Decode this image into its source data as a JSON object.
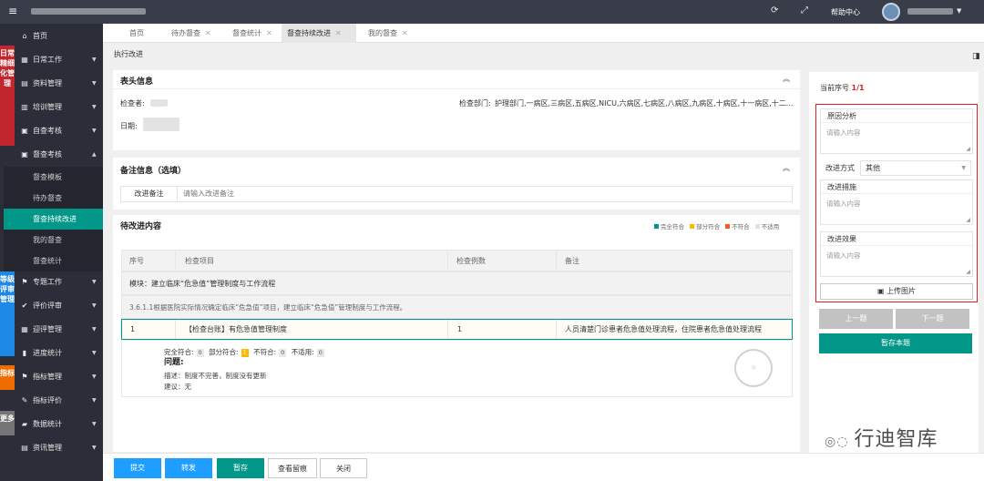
{
  "topbar": {
    "menu_icon": "hamburger-icon",
    "help_center": "帮助中心",
    "refresh_icon": "refresh-icon",
    "fullscreen_icon": "fullscreen-icon"
  },
  "sidebar": {
    "items": [
      {
        "label": "首页",
        "icon": "home-icon"
      },
      {
        "label": "日常工作",
        "icon": "calendar-icon"
      },
      {
        "label": "资料管理",
        "icon": "folder-icon"
      },
      {
        "label": "培训管理",
        "icon": "book-icon"
      },
      {
        "label": "自查考核",
        "icon": "clipboard-icon"
      },
      {
        "label": "督查考核",
        "icon": "clipboard-icon"
      },
      {
        "label": "专题工作",
        "icon": "flag-icon"
      },
      {
        "label": "评价评审",
        "icon": "check-icon"
      },
      {
        "label": "迎评管理",
        "icon": "doc-icon"
      },
      {
        "label": "进度统计",
        "icon": "chart-icon"
      },
      {
        "label": "指标管理",
        "icon": "flag-icon"
      },
      {
        "label": "指标评价",
        "icon": "wrench-icon"
      },
      {
        "label": "数据统计",
        "icon": "stats-icon"
      },
      {
        "label": "资讯管理",
        "icon": "news-icon"
      }
    ],
    "subitems": [
      {
        "label": "督查模板"
      },
      {
        "label": "待办督查"
      },
      {
        "label": "督查持续改进"
      },
      {
        "label": "我的督查"
      },
      {
        "label": "督查统计"
      }
    ],
    "tags": {
      "daily": "日常精细化管理",
      "grade": "等级评审管理",
      "index": "指标",
      "more": "更多"
    },
    "colors": {
      "daily": "#c1272d",
      "grade": "#1e88e5",
      "index": "#ef6c00",
      "more": "#757575"
    }
  },
  "tabs": [
    {
      "label": "首页"
    },
    {
      "label": "待办督查"
    },
    {
      "label": "督查统计"
    },
    {
      "label": "督查持续改进"
    },
    {
      "label": "我的督查"
    }
  ],
  "breadcrumb": "执行改进",
  "header_info": {
    "title": "表头信息",
    "inspector_label": "检查者:",
    "date_label": "日期:",
    "dept_label": "检查部门:",
    "dept_value": "护理部门,一病区,三病区,五病区,NICU,六病区,七病区,八病区,九病区,十病区,十一病区,十二..."
  },
  "remarks": {
    "title": "备注信息（选填）",
    "label": "改进备注",
    "placeholder": "请输入改进备注"
  },
  "pending": {
    "title": "待改进内容",
    "legend": [
      {
        "label": "完全符合",
        "color": "#009688"
      },
      {
        "label": "部分符合",
        "color": "#ffb800"
      },
      {
        "label": "不符合",
        "color": "#ff5722"
      },
      {
        "label": "不适用",
        "color": "#e2e2e2"
      }
    ],
    "columns": [
      "序号",
      "检查项目",
      "检查例数",
      "备注"
    ],
    "module": "模块：建立临床“危急值”管理制度与工作流程",
    "clause": "3.6.1.1根据医院实际情况确定临床“危急值”项目，建立临床“危急值”管理制度与工作流程。",
    "row": {
      "no": "1",
      "item": "【检查台账】有危急值管理制度",
      "count": "1",
      "note": "人员清楚门诊患者危急值处理流程，住院患者危急值处理流程"
    },
    "stats": {
      "full_label": "完全符合:",
      "full": "0",
      "part_label": "部分符合:",
      "part": "1",
      "non_label": "不符合:",
      "non": "0",
      "na_label": "不适用:",
      "na": "0"
    },
    "issue_title": "问题:",
    "desc": "描述：制度不完善，制度没有更新",
    "advice": "建议：无"
  },
  "right_panel": {
    "current_label": "当前序号",
    "current_value": "1/1",
    "cause_label": "原因分析",
    "cause_placeholder": "请输入内容",
    "method_label": "改进方式",
    "method_value": "其他",
    "measure_label": "改进措施",
    "measure_placeholder": "请输入内容",
    "effect_label": "改进效果",
    "effect_placeholder": "请输入内容",
    "upload_label": "上传图片",
    "prev_label": "上一题",
    "next_label": "下一题",
    "save_label": "暂存本题"
  },
  "bottom": {
    "submit": "提交",
    "forward": "转发",
    "save": "暂存",
    "trace": "查看留痕",
    "close": "关闭"
  },
  "watermark": "行迪智库"
}
